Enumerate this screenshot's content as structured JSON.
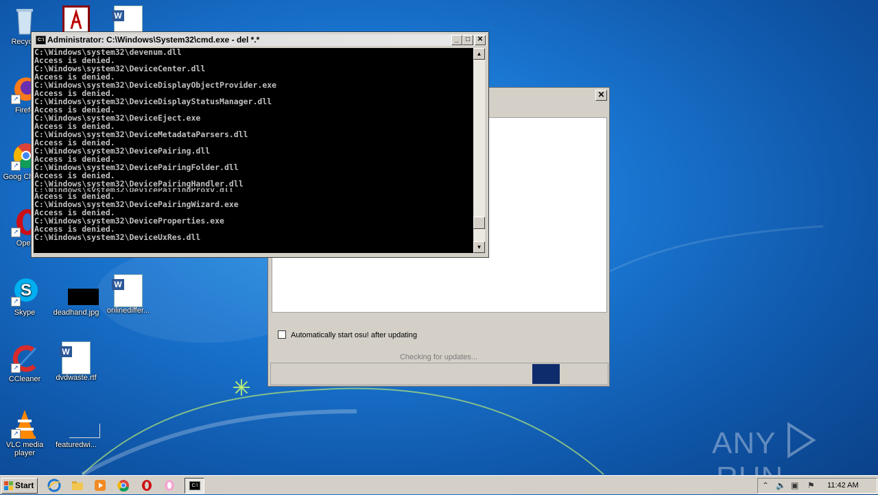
{
  "desktop": {
    "icons": [
      {
        "label": "Recycle",
        "icon": "recycle-bin-icon"
      },
      {
        "label": "",
        "icon": "pdf-icon"
      },
      {
        "label": "",
        "icon": "word-doc-icon"
      },
      {
        "label": "Firefo",
        "icon": "firefox-icon"
      },
      {
        "label": "Goog Chrom",
        "icon": "chrome-icon"
      },
      {
        "label": "Oper",
        "icon": "opera-icon"
      },
      {
        "label": "Skype",
        "icon": "skype-icon"
      },
      {
        "label": "deadhand.jpg",
        "icon": "image-file-icon"
      },
      {
        "label": "onlinediffer...",
        "icon": "word-doc-icon"
      },
      {
        "label": "CCleaner",
        "icon": "ccleaner-icon"
      },
      {
        "label": "dvdwaste.rtf",
        "icon": "word-doc-icon"
      },
      {
        "label": "VLC media player",
        "icon": "vlc-icon"
      },
      {
        "label": "featuredwi...",
        "icon": "image-file-icon"
      }
    ]
  },
  "cmd": {
    "title": "Administrator: C:\\Windows\\System32\\cmd.exe - del  *.*",
    "icon_text": "C:\\",
    "lines": [
      "C:\\Windows\\system32\\devenum.dll",
      "Access is denied.",
      "C:\\Windows\\system32\\DeviceCenter.dll",
      "Access is denied.",
      "C:\\Windows\\system32\\DeviceDisplayObjectProvider.exe",
      "Access is denied.",
      "C:\\Windows\\system32\\DeviceDisplayStatusManager.dll",
      "Access is denied.",
      "C:\\Windows\\system32\\DeviceEject.exe",
      "Access is denied.",
      "C:\\Windows\\system32\\DeviceMetadataParsers.dll",
      "Access is denied.",
      "C:\\Windows\\system32\\DevicePairing.dll",
      "Access is denied.",
      "C:\\Windows\\system32\\DevicePairingFolder.dll",
      "Access is denied.",
      "C:\\Windows\\system32\\DevicePairingHandler.dll",
      "C:\\Windows\\system32\\DevicePairingProxy.dll",
      "Access is denied.",
      "C:\\Windows\\system32\\DevicePairingWizard.exe",
      "Access is denied.",
      "C:\\Windows\\system32\\DeviceProperties.exe",
      "Access is denied.",
      "C:\\Windows\\system32\\DeviceUxRes.dll"
    ],
    "scroll_position": 0.92
  },
  "osu": {
    "checkbox_label": "Automatically start osu! after updating",
    "checkbox_checked": false,
    "status": "Checking for updates...",
    "accent": "#0e2b6b"
  },
  "watermark": {
    "left": "ANY",
    "right": "RUN"
  },
  "taskbar": {
    "start_label": "Start",
    "clock": "11:42 AM",
    "pinned": [
      "ie-icon",
      "explorer-icon",
      "media-player-icon",
      "chrome-icon",
      "opera-icon",
      "paint-icon",
      "cmd-icon"
    ]
  }
}
